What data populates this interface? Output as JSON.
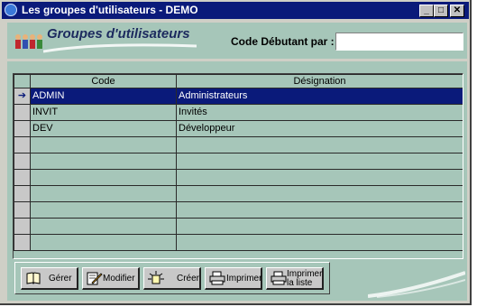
{
  "window": {
    "title": "Les groupes d'utilisateurs - DEMO",
    "controls": {
      "minimize": "_",
      "maximize": "□",
      "close": "✕"
    }
  },
  "header": {
    "logo_text": "Groupes d'utilisateurs",
    "search_label": "Code Débutant par :",
    "search_value": ""
  },
  "table": {
    "columns": [
      "Code",
      "Désignation"
    ],
    "rows": [
      {
        "code": "ADMIN",
        "designation": "Administrateurs"
      },
      {
        "code": "INVIT",
        "designation": "Invités"
      },
      {
        "code": "DEV",
        "designation": "Développeur"
      }
    ],
    "current_row_marker": "➔",
    "selected_row": 1
  },
  "toolbar": {
    "gerer": "Gérer",
    "modifier": "Modifier",
    "creer": "Créer",
    "imprimer": "Imprimer",
    "imprimer_liste_line1": "Imprimer",
    "imprimer_liste_line2": "la liste"
  },
  "icons": {
    "app": "window-app-icon",
    "logo": "users-group-icon",
    "gerer": "book-icon",
    "modifier": "pencil-edit-icon",
    "creer": "new-sparkle-icon",
    "imprimer": "printer-icon",
    "imprimer_liste": "printer-list-icon"
  },
  "colors": {
    "titlebar": "#0a1a7a",
    "panel": "#a6c6b9",
    "selection": "#0a1a7a"
  }
}
